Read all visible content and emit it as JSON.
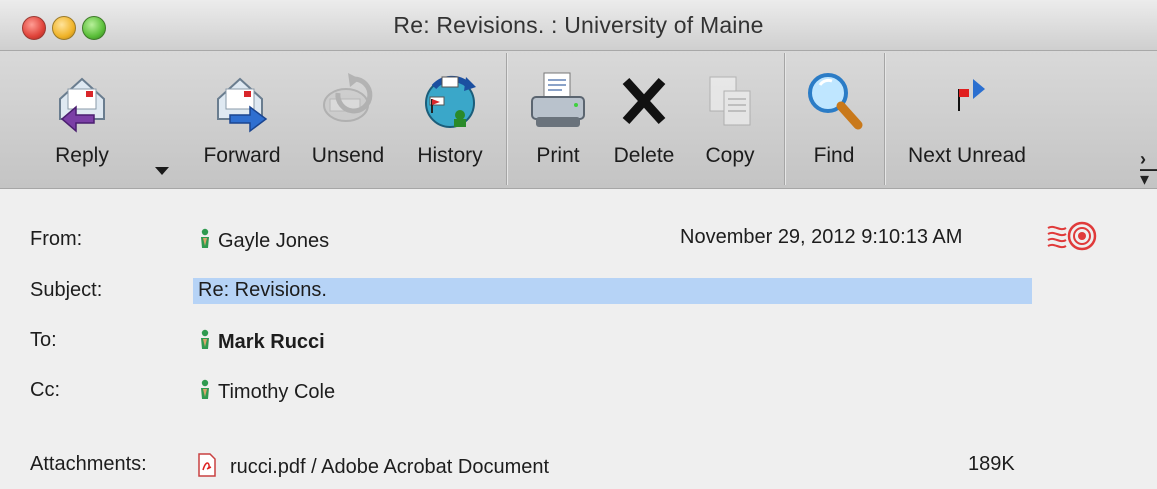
{
  "window": {
    "title": "Re: Revisions. : University of Maine"
  },
  "toolbar": {
    "buttons": [
      {
        "label": "Reply",
        "icon": "reply-icon"
      },
      {
        "label": "Forward",
        "icon": "forward-icon"
      },
      {
        "label": "Unsend",
        "icon": "unsend-icon",
        "disabled": true
      },
      {
        "label": "History",
        "icon": "history-icon"
      },
      {
        "label": "Print",
        "icon": "printer-icon"
      },
      {
        "label": "Delete",
        "icon": "delete-x-icon"
      },
      {
        "label": "Copy",
        "icon": "copy-icon",
        "disabled": true
      },
      {
        "label": "Find",
        "icon": "magnifier-icon"
      },
      {
        "label": "Next Unread",
        "icon": "next-unread-flag-icon"
      }
    ]
  },
  "headers": {
    "from_label": "From:",
    "from_value": "Gayle Jones",
    "date": "November 29, 2012 9:10:13 AM",
    "subject_label": "Subject:",
    "subject_value": "Re: Revisions.",
    "to_label": "To:",
    "to_value": "Mark Rucci",
    "cc_label": "Cc:",
    "cc_value": "Timothy Cole",
    "attachments_label": "Attachments:",
    "attachment_name": "rucci.pdf / Adobe Acrobat Document",
    "attachment_size": "189K"
  },
  "colors": {
    "subject_highlight": "#b6d3f6",
    "toolbar_bg": "#cfcfcf",
    "window_bg": "#efefef"
  }
}
